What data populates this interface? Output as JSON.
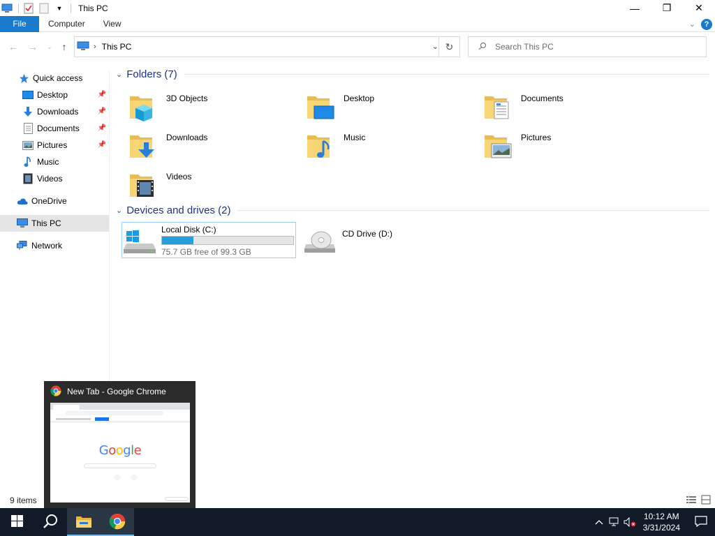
{
  "window": {
    "title": "This PC",
    "minimize_glyph": "—",
    "maximize_glyph": "❐",
    "close_glyph": "✕"
  },
  "ribbon": {
    "tabs": [
      {
        "label": "File",
        "active": true
      },
      {
        "label": "Computer"
      },
      {
        "label": "View"
      }
    ],
    "help_label": "?"
  },
  "address": {
    "path": "This PC",
    "search_placeholder": "Search This PC"
  },
  "nav_pane": {
    "items": [
      {
        "label": "Quick access",
        "icon": "star-icon"
      },
      {
        "label": "Desktop",
        "icon": "desktop-icon",
        "pinned": true
      },
      {
        "label": "Downloads",
        "icon": "download-icon",
        "pinned": true
      },
      {
        "label": "Documents",
        "icon": "document-icon",
        "pinned": true
      },
      {
        "label": "Pictures",
        "icon": "picture-icon",
        "pinned": true
      },
      {
        "label": "Music",
        "icon": "music-icon"
      },
      {
        "label": "Videos",
        "icon": "video-icon"
      },
      {
        "label": "OneDrive",
        "icon": "cloud-icon"
      },
      {
        "label": "This PC",
        "icon": "computer-icon",
        "selected": true
      },
      {
        "label": "Network",
        "icon": "network-icon"
      }
    ]
  },
  "content": {
    "folders_header": "Folders (7)",
    "folders": [
      {
        "label": "3D Objects",
        "icon": "cube-icon"
      },
      {
        "label": "Desktop",
        "icon": "desktop-icon"
      },
      {
        "label": "Documents",
        "icon": "document-icon"
      },
      {
        "label": "Downloads",
        "icon": "download-icon"
      },
      {
        "label": "Music",
        "icon": "music-icon"
      },
      {
        "label": "Pictures",
        "icon": "picture-icon"
      },
      {
        "label": "Videos",
        "icon": "video-icon"
      }
    ],
    "drives_header": "Devices and drives (2)",
    "drives": [
      {
        "label": "Local Disk (C:)",
        "free_text": "75.7 GB free of 99.3 GB",
        "used_fraction": 0.238
      },
      {
        "label": "CD Drive (D:)"
      }
    ]
  },
  "status": {
    "item_count": "9 items"
  },
  "thumbnail": {
    "title": "New Tab - Google Chrome",
    "preview_logo": "Google"
  },
  "taskbar": {
    "time": "10:12 AM",
    "date": "3/31/2024"
  },
  "colors": {
    "accent": "#1979ca",
    "group_header": "#1e3287",
    "taskbar_bg": "#101b27",
    "progress_fill": "#26a0da"
  }
}
